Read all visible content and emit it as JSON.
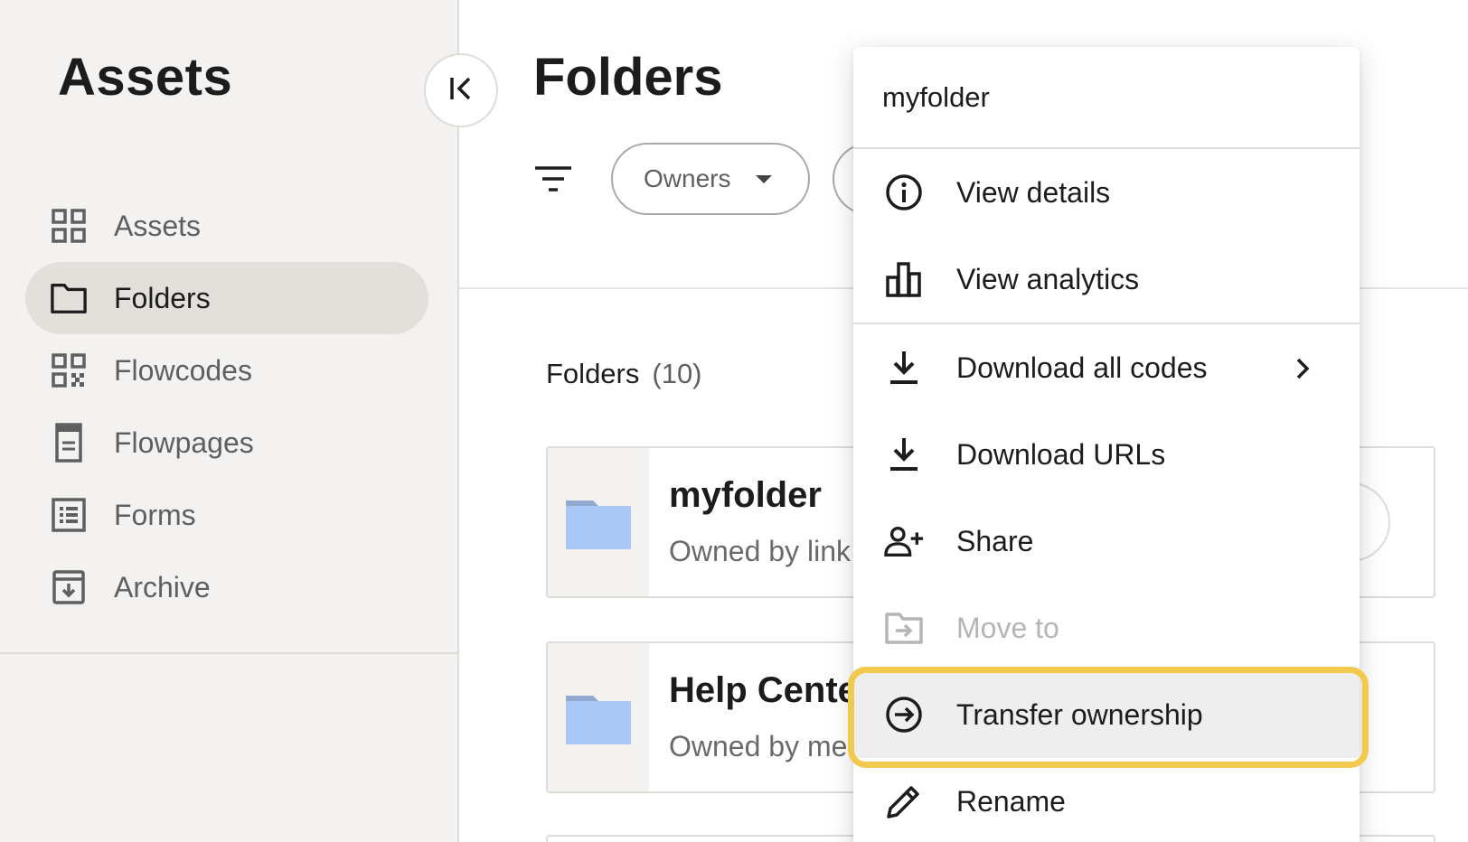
{
  "sidebar": {
    "title": "Assets",
    "items": [
      {
        "label": "Assets",
        "icon": "grid-icon",
        "active": false
      },
      {
        "label": "Folders",
        "icon": "folder-icon",
        "active": true
      },
      {
        "label": "Flowcodes",
        "icon": "qr-code-icon",
        "active": false
      },
      {
        "label": "Flowpages",
        "icon": "page-icon",
        "active": false
      },
      {
        "label": "Forms",
        "icon": "form-list-icon",
        "active": false
      },
      {
        "label": "Archive",
        "icon": "archive-icon",
        "active": false
      }
    ]
  },
  "main": {
    "title": "Folders",
    "filters": {
      "owners_label": "Owners"
    },
    "section": {
      "label": "Folders",
      "count": "(10)"
    },
    "folders": [
      {
        "name": "myfolder",
        "owner": "Owned by link"
      },
      {
        "name": "Help Center",
        "owner": "Owned by me"
      }
    ]
  },
  "context_menu": {
    "title": "myfolder",
    "items": [
      {
        "label": "View details",
        "icon": "info-icon"
      },
      {
        "label": "View analytics",
        "icon": "analytics-icon"
      },
      {
        "label": "Download all codes",
        "icon": "download-icon",
        "has_submenu": true
      },
      {
        "label": "Download URLs",
        "icon": "download-icon"
      },
      {
        "label": "Share",
        "icon": "add-person-icon"
      },
      {
        "label": "Move to",
        "icon": "move-folder-icon",
        "disabled": true
      },
      {
        "label": "Transfer ownership",
        "icon": "arrow-circle-icon",
        "highlighted": true
      },
      {
        "label": "Rename",
        "icon": "pencil-icon"
      }
    ]
  },
  "colors": {
    "sidebar_bg": "#f3f2f0",
    "active_nav_bg": "#e3dfda",
    "folder_blue": "#a9c8f5",
    "highlight_ring": "#f2c94c"
  }
}
